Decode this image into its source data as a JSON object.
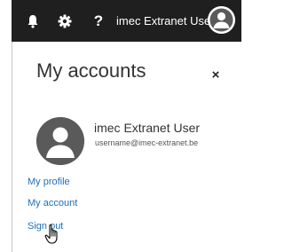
{
  "topbar": {
    "bell_icon": "bell-icon",
    "gear_icon": "gear-icon",
    "help_label": "?",
    "user_name": "imec Extranet User",
    "avatar_icon": "avatar-icon"
  },
  "panel": {
    "title": "My accounts",
    "close_label": "×",
    "user_name": "imec Extranet User",
    "user_email": "username@imec-extranet.be",
    "links": {
      "profile": "My profile",
      "account": "My account",
      "signout": "Sign out"
    }
  },
  "colors": {
    "topbar_bg": "#1f1f1f",
    "link": "#1f6fb5",
    "avatar_bg": "#5a5a5a"
  }
}
